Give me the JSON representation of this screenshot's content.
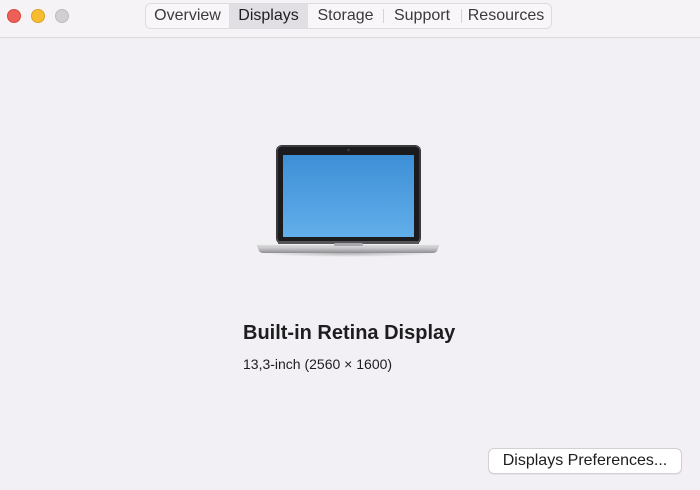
{
  "window": {
    "controls": {
      "close_icon": "close-icon",
      "minimize_icon": "minimize-icon",
      "zoom_icon": "zoom-icon"
    },
    "tabs": [
      {
        "label": "Overview",
        "active": false
      },
      {
        "label": "Displays",
        "active": true
      },
      {
        "label": "Storage",
        "active": false
      },
      {
        "label": "Support",
        "active": false
      },
      {
        "label": "Resources",
        "active": false
      }
    ]
  },
  "display": {
    "illustration_icon": "laptop-icon",
    "name": "Built-in Retina Display",
    "spec": "13,3-inch (2560 × 1600)"
  },
  "actions": {
    "preferences_label": "Displays Preferences..."
  },
  "colors": {
    "close": "#ee5f57",
    "minimize": "#f5bd2f",
    "zoom_disabled": "#d2cfd4",
    "screen_top": "#3d8fd6",
    "screen_bottom": "#62aeea"
  }
}
